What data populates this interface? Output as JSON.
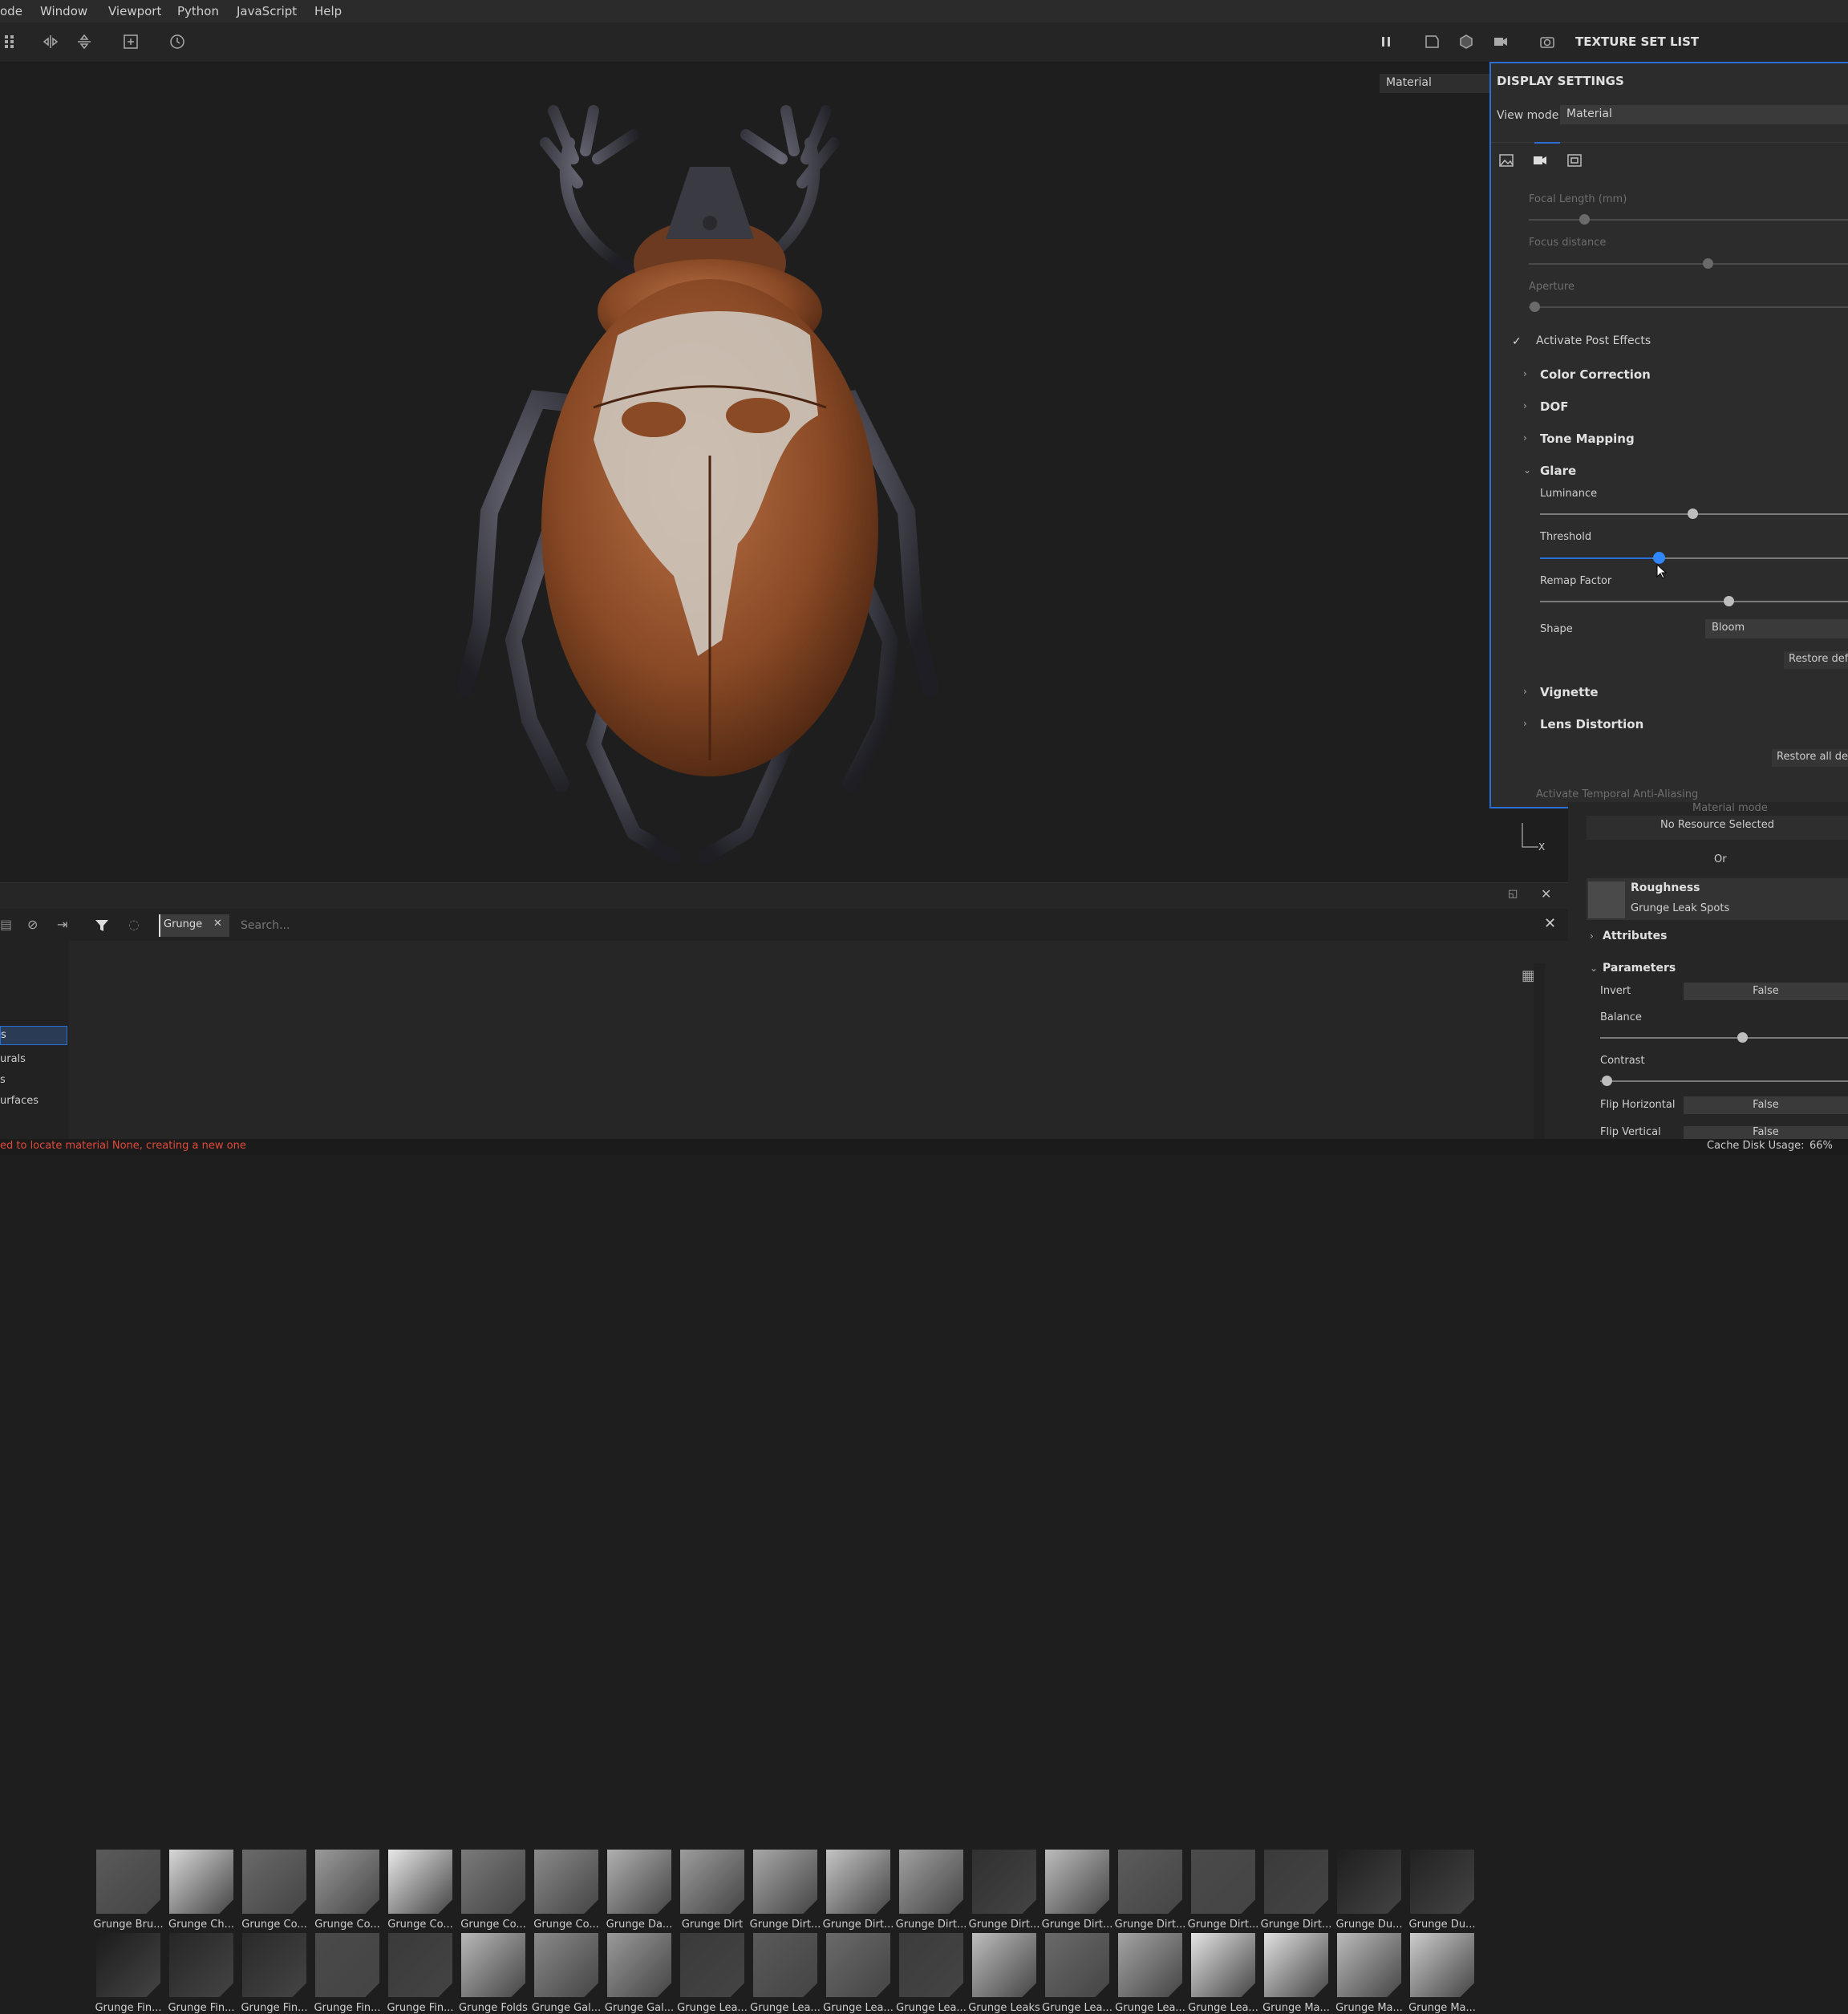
{
  "menu": {
    "items": [
      "ode",
      "Window",
      "Viewport",
      "Python",
      "JavaScript",
      "Help"
    ]
  },
  "toolbar": {
    "texture_set_list": "TEXTURE SET LIST",
    "viewport_mode": "Material"
  },
  "display_settings": {
    "title": "DISPLAY SETTINGS",
    "view_mode_label": "View mode",
    "view_mode_value": "Material",
    "tabs": [
      "image-icon",
      "camera-icon",
      "frame-icon"
    ],
    "camera": [
      {
        "label": "Focal Length (mm)",
        "value": 0.1
      },
      {
        "label": "Focus distance",
        "value": 0.56
      },
      {
        "label": "Aperture",
        "value": 0.02
      }
    ],
    "activate_post_effects": "Activate Post Effects",
    "sections": [
      "Color Correction",
      "DOF",
      "Tone Mapping"
    ],
    "glare": {
      "title": "Glare",
      "luminance_label": "Luminance",
      "luminance": 0.52,
      "threshold_label": "Threshold",
      "threshold": 0.4,
      "remap_label": "Remap Factor",
      "remap": 0.65,
      "shape_label": "Shape",
      "shape_value": "Bloom",
      "restore": "Restore def"
    },
    "sections_after": [
      "Vignette",
      "Lens Distortion"
    ],
    "restore_all": "Restore all def",
    "cut_off": "Activate Temporal Anti-Aliasing"
  },
  "right_panel": {
    "material_mode": "Material mode",
    "no_resource": "No Resource Selected",
    "or": "Or",
    "channel": "Roughness",
    "resource": "Grunge Leak Spots",
    "attributes": "Attributes",
    "parameters": "Parameters",
    "params": [
      {
        "label": "Invert",
        "value": "False"
      },
      {
        "label": "Balance",
        "level": 0.54
      },
      {
        "label": "Contrast",
        "level": 0.02
      },
      {
        "label": "Flip Horizontal",
        "value": "False"
      },
      {
        "label": "Flip Vertical",
        "value": "False"
      }
    ]
  },
  "shelf": {
    "filter_tag": "Grunge",
    "search_placeholder": "Search...",
    "categories": [
      "s",
      "urals",
      "s",
      "urfaces"
    ],
    "row1": [
      "Grunge Bru...",
      "Grunge Ch...",
      "Grunge Co...",
      "Grunge Co...",
      "Grunge Co...",
      "Grunge Co...",
      "Grunge Co...",
      "Grunge Da...",
      "Grunge Dirt",
      "Grunge Dirt...",
      "Grunge Dirt...",
      "Grunge Dirt...",
      "Grunge Dirt...",
      "Grunge Dirt...",
      "Grunge Dirt...",
      "Grunge Dirt...",
      "Grunge Dirt...",
      "Grunge Du...",
      "Grunge Du..."
    ],
    "row2": [
      "Grunge Fin...",
      "Grunge Fin...",
      "Grunge Fin...",
      "Grunge Fin...",
      "Grunge Fin...",
      "Grunge Folds",
      "Grunge Gal...",
      "Grunge Gal...",
      "Grunge Lea...",
      "Grunge Lea...",
      "Grunge Lea...",
      "Grunge Lea...",
      "Grunge Leaks",
      "Grunge Lea...",
      "Grunge Lea...",
      "Grunge Lea...",
      "Grunge Ma...",
      "Grunge Ma...",
      "Grunge Ma..."
    ]
  },
  "status": {
    "error": "ed to locate material None, creating a new one",
    "cache": "Cache Disk Usage:",
    "cache_value": "66%"
  },
  "colors": {
    "accent": "#2a6fd6",
    "error": "#e04a3a",
    "panel": "#2c2c2c"
  }
}
